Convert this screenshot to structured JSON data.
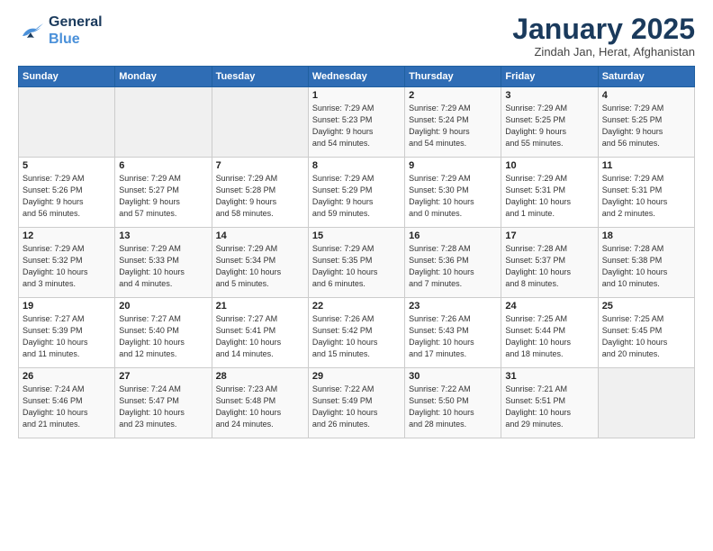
{
  "logo": {
    "line1": "General",
    "line2": "Blue"
  },
  "title": "January 2025",
  "subtitle": "Zindah Jan, Herat, Afghanistan",
  "headers": [
    "Sunday",
    "Monday",
    "Tuesday",
    "Wednesday",
    "Thursday",
    "Friday",
    "Saturday"
  ],
  "weeks": [
    [
      {
        "day": "",
        "info": ""
      },
      {
        "day": "",
        "info": ""
      },
      {
        "day": "",
        "info": ""
      },
      {
        "day": "1",
        "info": "Sunrise: 7:29 AM\nSunset: 5:23 PM\nDaylight: 9 hours\nand 54 minutes."
      },
      {
        "day": "2",
        "info": "Sunrise: 7:29 AM\nSunset: 5:24 PM\nDaylight: 9 hours\nand 54 minutes."
      },
      {
        "day": "3",
        "info": "Sunrise: 7:29 AM\nSunset: 5:25 PM\nDaylight: 9 hours\nand 55 minutes."
      },
      {
        "day": "4",
        "info": "Sunrise: 7:29 AM\nSunset: 5:25 PM\nDaylight: 9 hours\nand 56 minutes."
      }
    ],
    [
      {
        "day": "5",
        "info": "Sunrise: 7:29 AM\nSunset: 5:26 PM\nDaylight: 9 hours\nand 56 minutes."
      },
      {
        "day": "6",
        "info": "Sunrise: 7:29 AM\nSunset: 5:27 PM\nDaylight: 9 hours\nand 57 minutes."
      },
      {
        "day": "7",
        "info": "Sunrise: 7:29 AM\nSunset: 5:28 PM\nDaylight: 9 hours\nand 58 minutes."
      },
      {
        "day": "8",
        "info": "Sunrise: 7:29 AM\nSunset: 5:29 PM\nDaylight: 9 hours\nand 59 minutes."
      },
      {
        "day": "9",
        "info": "Sunrise: 7:29 AM\nSunset: 5:30 PM\nDaylight: 10 hours\nand 0 minutes."
      },
      {
        "day": "10",
        "info": "Sunrise: 7:29 AM\nSunset: 5:31 PM\nDaylight: 10 hours\nand 1 minute."
      },
      {
        "day": "11",
        "info": "Sunrise: 7:29 AM\nSunset: 5:31 PM\nDaylight: 10 hours\nand 2 minutes."
      }
    ],
    [
      {
        "day": "12",
        "info": "Sunrise: 7:29 AM\nSunset: 5:32 PM\nDaylight: 10 hours\nand 3 minutes."
      },
      {
        "day": "13",
        "info": "Sunrise: 7:29 AM\nSunset: 5:33 PM\nDaylight: 10 hours\nand 4 minutes."
      },
      {
        "day": "14",
        "info": "Sunrise: 7:29 AM\nSunset: 5:34 PM\nDaylight: 10 hours\nand 5 minutes."
      },
      {
        "day": "15",
        "info": "Sunrise: 7:29 AM\nSunset: 5:35 PM\nDaylight: 10 hours\nand 6 minutes."
      },
      {
        "day": "16",
        "info": "Sunrise: 7:28 AM\nSunset: 5:36 PM\nDaylight: 10 hours\nand 7 minutes."
      },
      {
        "day": "17",
        "info": "Sunrise: 7:28 AM\nSunset: 5:37 PM\nDaylight: 10 hours\nand 8 minutes."
      },
      {
        "day": "18",
        "info": "Sunrise: 7:28 AM\nSunset: 5:38 PM\nDaylight: 10 hours\nand 10 minutes."
      }
    ],
    [
      {
        "day": "19",
        "info": "Sunrise: 7:27 AM\nSunset: 5:39 PM\nDaylight: 10 hours\nand 11 minutes."
      },
      {
        "day": "20",
        "info": "Sunrise: 7:27 AM\nSunset: 5:40 PM\nDaylight: 10 hours\nand 12 minutes."
      },
      {
        "day": "21",
        "info": "Sunrise: 7:27 AM\nSunset: 5:41 PM\nDaylight: 10 hours\nand 14 minutes."
      },
      {
        "day": "22",
        "info": "Sunrise: 7:26 AM\nSunset: 5:42 PM\nDaylight: 10 hours\nand 15 minutes."
      },
      {
        "day": "23",
        "info": "Sunrise: 7:26 AM\nSunset: 5:43 PM\nDaylight: 10 hours\nand 17 minutes."
      },
      {
        "day": "24",
        "info": "Sunrise: 7:25 AM\nSunset: 5:44 PM\nDaylight: 10 hours\nand 18 minutes."
      },
      {
        "day": "25",
        "info": "Sunrise: 7:25 AM\nSunset: 5:45 PM\nDaylight: 10 hours\nand 20 minutes."
      }
    ],
    [
      {
        "day": "26",
        "info": "Sunrise: 7:24 AM\nSunset: 5:46 PM\nDaylight: 10 hours\nand 21 minutes."
      },
      {
        "day": "27",
        "info": "Sunrise: 7:24 AM\nSunset: 5:47 PM\nDaylight: 10 hours\nand 23 minutes."
      },
      {
        "day": "28",
        "info": "Sunrise: 7:23 AM\nSunset: 5:48 PM\nDaylight: 10 hours\nand 24 minutes."
      },
      {
        "day": "29",
        "info": "Sunrise: 7:22 AM\nSunset: 5:49 PM\nDaylight: 10 hours\nand 26 minutes."
      },
      {
        "day": "30",
        "info": "Sunrise: 7:22 AM\nSunset: 5:50 PM\nDaylight: 10 hours\nand 28 minutes."
      },
      {
        "day": "31",
        "info": "Sunrise: 7:21 AM\nSunset: 5:51 PM\nDaylight: 10 hours\nand 29 minutes."
      },
      {
        "day": "",
        "info": ""
      }
    ]
  ]
}
